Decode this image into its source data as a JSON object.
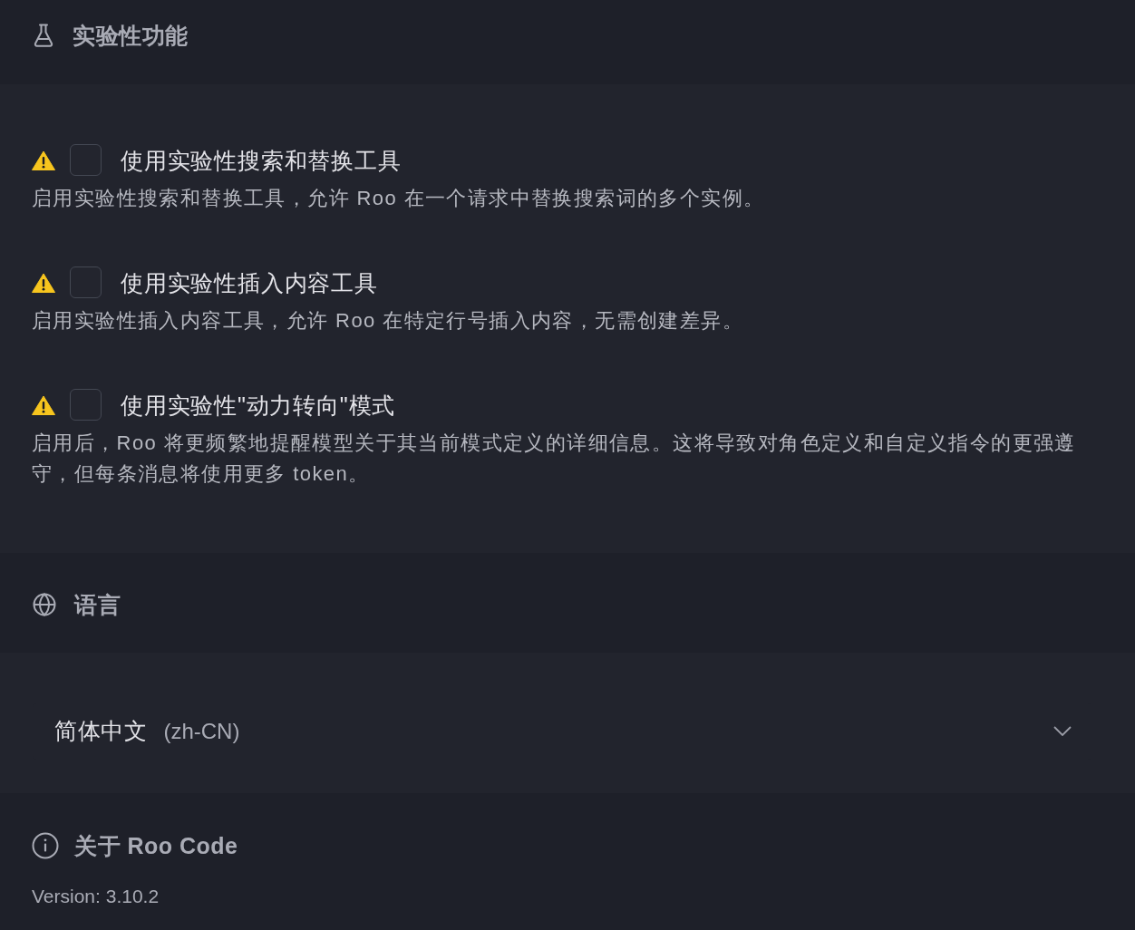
{
  "experimental": {
    "title": "实验性功能",
    "features": [
      {
        "label": "使用实验性搜索和替换工具",
        "description": "启用实验性搜索和替换工具，允许 Roo 在一个请求中替换搜索词的多个实例。",
        "checked": false
      },
      {
        "label": "使用实验性插入内容工具",
        "description": "启用实验性插入内容工具，允许 Roo 在特定行号插入内容，无需创建差异。",
        "checked": false
      },
      {
        "label": "使用实验性\"动力转向\"模式",
        "description": "启用后，Roo 将更频繁地提醒模型关于其当前模式定义的详细信息。这将导致对角色定义和自定义指令的更强遵守，但每条消息将使用更多 token。",
        "checked": false
      }
    ]
  },
  "language": {
    "title": "语言",
    "dropdown": {
      "value": "简体中文",
      "detail": "(zh-CN)"
    }
  },
  "about": {
    "title": "关于 Roo Code",
    "version": "Version: 3.10.2"
  }
}
